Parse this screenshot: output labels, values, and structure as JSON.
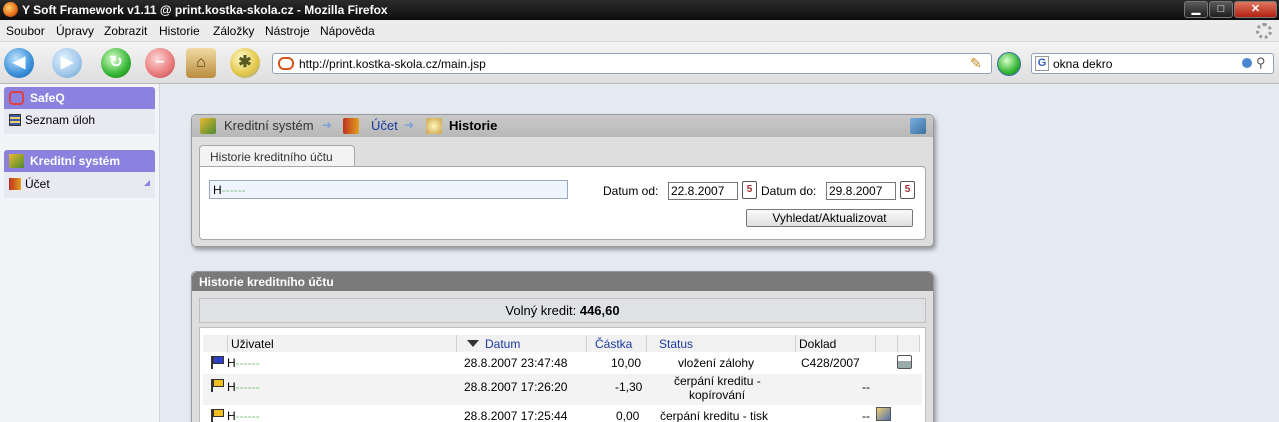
{
  "window": {
    "title": "Y Soft Framework v1.11 @ print.kostka-skola.cz - Mozilla Firefox"
  },
  "menu": [
    "Soubor",
    "Úpravy",
    "Zobrazit",
    "Historie",
    "Záložky",
    "Nástroje",
    "Nápověda"
  ],
  "navbar": {
    "url": "http://print.kostka-skola.cz/main.jsp",
    "search_query": "okna dekro"
  },
  "sidebar": {
    "sections": [
      {
        "title": "SafeQ",
        "items": [
          "Seznam úloh"
        ]
      },
      {
        "title": "Kreditní systém",
        "items": [
          "Účet"
        ]
      }
    ]
  },
  "breadcrumb": {
    "root": "Kreditní systém",
    "middle": "Účet",
    "current": "Historie"
  },
  "filter": {
    "tab": "Historie kreditního účtu",
    "user_value": "H",
    "date_from_label": "Datum od:",
    "date_from": "22.8.2007",
    "date_to_label": "Datum do:",
    "date_to": "29.8.2007",
    "search_button": "Vyhledat/Aktualizovat"
  },
  "history": {
    "title": "Historie kreditního účtu",
    "credit_label": "Volný kredit:",
    "credit_value": "446,60",
    "columns": [
      "Uživatel",
      "Datum",
      "Částka",
      "Status",
      "Doklad"
    ],
    "rows": [
      {
        "user": "H",
        "date": "28.8.2007 23:47:48",
        "amount": "10,00",
        "status": "vložení zálohy",
        "status2": "",
        "doc": "C428/2007"
      },
      {
        "user": "H",
        "date": "28.8.2007 17:26:20",
        "amount": "-1,30",
        "status": "čerpání kreditu -",
        "status2": "kopírování",
        "doc": "--"
      },
      {
        "user": "H",
        "date": "28.8.2007 17:25:44",
        "amount": "0,00",
        "status": "čerpání kreditu - tisk",
        "status2": "",
        "doc": "--"
      }
    ]
  },
  "colors": {
    "sidebar_header": "#8b82e0",
    "panel_header": "#7a7a7a",
    "link": "#1a3aa0",
    "flag_blue": "#3040c8",
    "flag_yellow": "#f0c020"
  }
}
